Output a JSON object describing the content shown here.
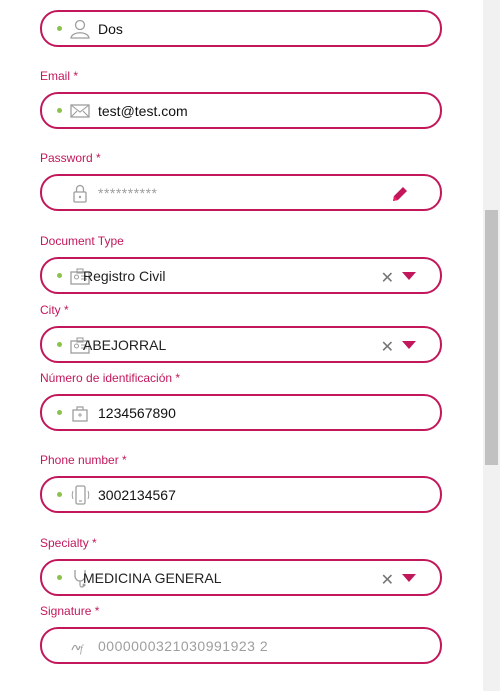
{
  "form": {
    "lastname": {
      "value": "Dos",
      "icon": "user-icon"
    },
    "email": {
      "label": "Email *",
      "value": "test@test.com",
      "icon": "envelope-icon"
    },
    "password": {
      "label": "Password *",
      "value": "**********",
      "icon": "lock-icon",
      "action_icon": "pencil-icon"
    },
    "document_type": {
      "label": "Document Type",
      "value": "Registro Civil",
      "icon": "id-card-icon"
    },
    "city": {
      "label": "City *",
      "value": "ABEJORRAL",
      "icon": "id-card-icon"
    },
    "id_number": {
      "label": "Número de identificación *",
      "value": "1234567890",
      "icon": "briefcase-icon"
    },
    "phone": {
      "label": "Phone number *",
      "value": "3002134567",
      "icon": "phone-icon"
    },
    "specialty": {
      "label": "Specialty *",
      "value": "MEDICINA GENERAL",
      "icon": "stethoscope-icon"
    },
    "signature": {
      "label": "Signature *",
      "value": "0000000321030991923 2",
      "icon": "signature-icon"
    }
  },
  "colors": {
    "accent": "#c2185b",
    "dot": "#8bc34a",
    "muted": "#9e9e9e"
  }
}
